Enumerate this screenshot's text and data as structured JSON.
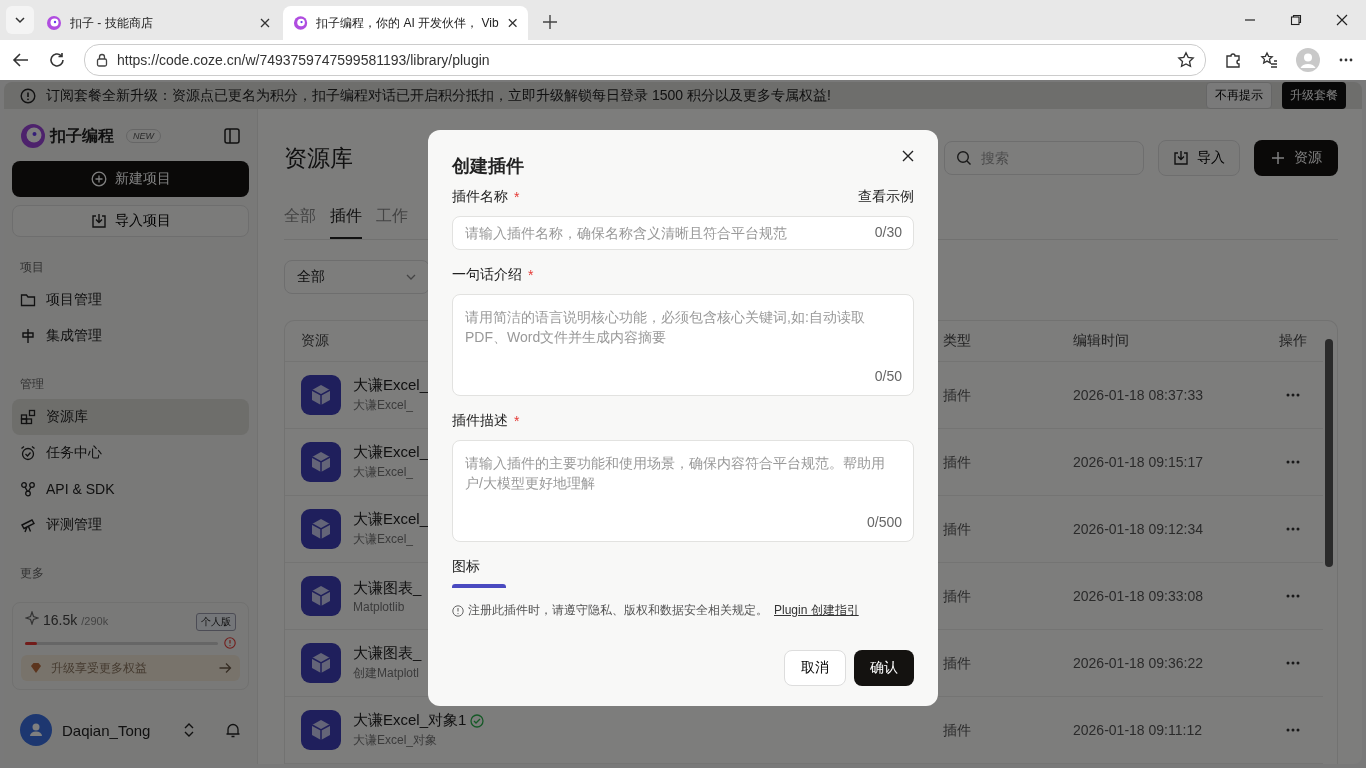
{
  "browser": {
    "tabs": [
      {
        "title": "扣子 - 技能商店",
        "selected": false
      },
      {
        "title": "扣子编程，你的 AI 开发伙伴， Vib",
        "selected": true
      }
    ],
    "url": "https://code.coze.cn/w/7493759747599581193/library/plugin"
  },
  "banner": {
    "text": "订阅套餐全新升级：资源点已更名为积分，扣子编程对话已开启积分抵扣，立即升级解锁每日登录 1500 积分以及更多专属权益!",
    "dismiss": "不再提示",
    "upgrade": "升级套餐"
  },
  "sidebar": {
    "brand": "扣子编程",
    "badge": "NEW",
    "new_project": "新建项目",
    "import_project": "导入项目",
    "sections": [
      {
        "title": "项目",
        "items": [
          {
            "label": "项目管理",
            "selected": false
          },
          {
            "label": "集成管理",
            "selected": false
          }
        ]
      },
      {
        "title": "管理",
        "items": [
          {
            "label": "资源库",
            "selected": true
          },
          {
            "label": "任务中心",
            "selected": false
          },
          {
            "label": "API & SDK",
            "selected": false
          },
          {
            "label": "评测管理",
            "selected": false
          }
        ]
      }
    ],
    "more_title": "更多",
    "credits": {
      "used": "16.5k",
      "total": "/290k",
      "plan": "个人版",
      "level": 0.06,
      "upgrade": "升级享受更多权益"
    },
    "user": {
      "name": "Daqian_Tong"
    }
  },
  "main": {
    "title": "资源库",
    "search_placeholder": "搜索",
    "import": "导入",
    "add": "资源",
    "tabs": [
      {
        "label": "全部",
        "selected": false
      },
      {
        "label": "插件",
        "selected": true
      },
      {
        "label": "工作",
        "selected": false
      }
    ],
    "filter": "全部",
    "table": {
      "columns": [
        "资源",
        "类型",
        "编辑时间",
        "操作"
      ],
      "rows": [
        {
          "name": "大谦Excel_",
          "description": "大谦Excel_",
          "type": "插件",
          "time": "2026-01-18 08:37:33",
          "verified": false
        },
        {
          "name": "大谦Excel_",
          "description": "大谦Excel_",
          "type": "插件",
          "time": "2026-01-18 09:15:17",
          "verified": false
        },
        {
          "name": "大谦Excel_",
          "description": "大谦Excel_",
          "type": "插件",
          "time": "2026-01-18 09:12:34",
          "verified": false
        },
        {
          "name": "大谦图表_",
          "description": "Matplotlib",
          "type": "插件",
          "time": "2026-01-18 09:33:08",
          "verified": false
        },
        {
          "name": "大谦图表_",
          "description": "创建Matplotl",
          "type": "插件",
          "time": "2026-01-18 09:36:22",
          "verified": false
        },
        {
          "name": "大谦Excel_对象1",
          "description": "大谦Excel_对象",
          "type": "插件",
          "time": "2026-01-18 09:11:12",
          "verified": true
        }
      ]
    }
  },
  "dialog": {
    "title": "创建插件",
    "required_mark": "*",
    "fields": [
      {
        "label": "插件名称",
        "required": true,
        "kind": "input",
        "placeholder": "请输入插件名称，确保名称含义清晰且符合平台规范",
        "counter": "0/30",
        "link": "查看示例"
      },
      {
        "label": "一句话介绍",
        "required": true,
        "kind": "textarea",
        "placeholder": "请用简洁的语言说明核心功能，必须包含核心关键词,如:自动读取PDF、Word文件并生成内容摘要",
        "counter": "0/50"
      },
      {
        "label": "插件描述",
        "required": true,
        "kind": "textarea",
        "placeholder": "请输入插件的主要功能和使用场景，确保内容符合平台规范。帮助用户/大模型更好地理解",
        "counter": "0/500"
      }
    ],
    "icon_label": "图标",
    "notice": "注册此插件时，请遵守隐私、版权和数据安全相关规定。",
    "notice_link": "Plugin 创建指引",
    "cancel": "取消",
    "confirm": "确认"
  }
}
